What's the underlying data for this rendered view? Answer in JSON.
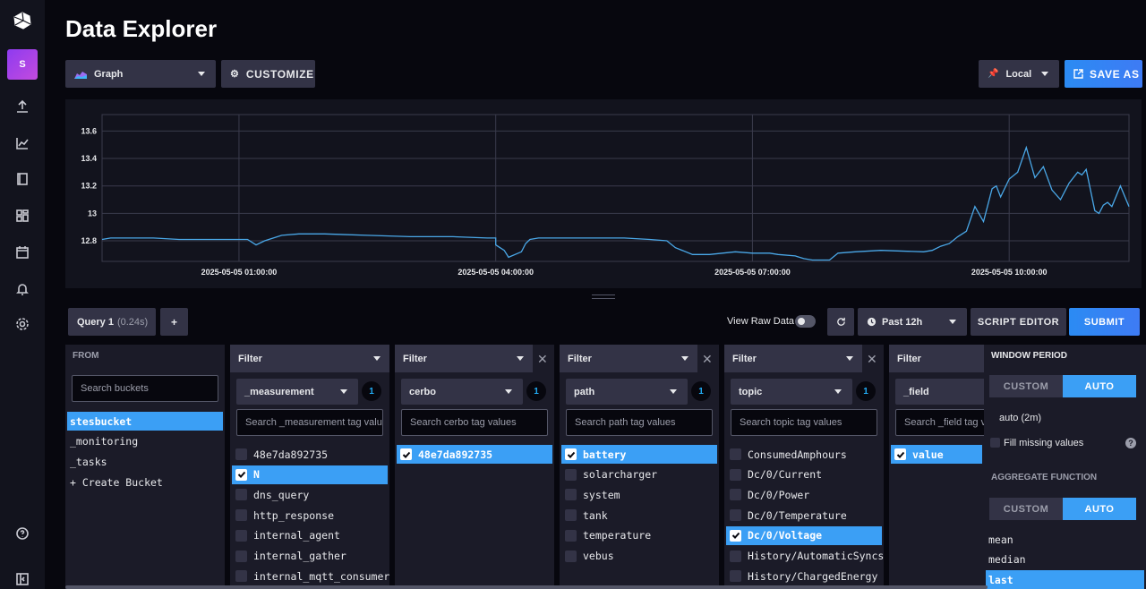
{
  "page": {
    "title": "Data Explorer"
  },
  "nav": {
    "user_initial": "S"
  },
  "toolbar": {
    "view_type": "Graph",
    "customize_label": "CUSTOMIZE",
    "timezone": "Local",
    "save_as_label": "SAVE AS"
  },
  "chart_data": {
    "type": "line",
    "title": "",
    "xlabel": "",
    "ylabel": "",
    "ylim": [
      12.65,
      13.72
    ],
    "yticks": [
      "12.8",
      "13",
      "13.2",
      "13.4",
      "13.6"
    ],
    "xticks": [
      "2025-05-05 01:00:00",
      "2025-05-05 04:00:00",
      "2025-05-05 07:00:00",
      "2025-05-05 10:00:00"
    ],
    "xrange_hours": [
      -0.6,
      11.4
    ],
    "color": "#4aa8e8",
    "series": [
      {
        "x": [
          -0.6,
          -0.5,
          -0.3,
          0,
          0.3,
          0.6,
          0.9,
          1.1,
          1.2,
          1.3,
          1.5,
          1.7,
          2,
          2.5,
          3,
          3.5,
          3.9,
          4,
          4.0,
          4.1,
          4.15,
          4.3,
          4.35,
          4.4,
          4.5,
          5,
          5.5,
          5.8,
          6,
          6.1,
          6.3,
          6.5,
          6.8,
          7,
          7.2,
          7.3,
          7.5,
          7.6,
          7.7,
          7.9,
          8,
          8.2,
          8.5,
          9,
          9.1,
          9.2,
          9.3,
          9.4,
          9.5,
          9.6,
          9.7,
          9.8,
          9.85,
          9.9,
          10,
          10.1,
          10.2,
          10.3,
          10.4,
          10.5,
          10.6,
          10.7,
          10.8,
          10.85,
          10.9,
          11,
          11.05,
          11.1,
          11.15,
          11.2,
          11.3,
          11.4
        ],
        "y": [
          12.81,
          12.82,
          12.82,
          12.82,
          12.81,
          12.81,
          12.81,
          12.81,
          12.77,
          12.8,
          12.84,
          12.85,
          12.85,
          12.84,
          12.83,
          12.83,
          12.82,
          12.82,
          12.77,
          12.73,
          12.68,
          12.72,
          12.78,
          12.81,
          12.82,
          12.82,
          12.82,
          12.81,
          12.8,
          12.75,
          12.7,
          12.7,
          12.72,
          12.71,
          12.71,
          12.7,
          12.69,
          12.67,
          12.66,
          12.66,
          12.71,
          12.72,
          12.73,
          12.72,
          12.73,
          12.76,
          12.78,
          12.83,
          12.87,
          13.05,
          12.94,
          13.18,
          13.2,
          13.12,
          13.25,
          13.3,
          13.48,
          13.26,
          13.34,
          13.17,
          13.1,
          13.22,
          13.3,
          13.28,
          13.32,
          13.02,
          13.0,
          13.06,
          13.08,
          13.05,
          13.2,
          13.05
        ]
      }
    ]
  },
  "query": {
    "tab_label": "Query 1",
    "tab_time": "(0.24s)",
    "add_label": "+",
    "view_raw_label": "View Raw Data",
    "time_range": "Past 12h",
    "script_editor_label": "SCRIPT EDITOR",
    "submit_label": "SUBMIT"
  },
  "from": {
    "title": "FROM",
    "search_placeholder": "Search buckets",
    "buckets": [
      "stesbucket",
      "_monitoring",
      "_tasks",
      "+ Create Bucket"
    ]
  },
  "filters": [
    {
      "head": "Filter",
      "key": "_measurement",
      "count": "1",
      "placeholder": "Search _measurement tag values",
      "items": [
        "48e7da892735",
        "N",
        "dns_query",
        "http_response",
        "internal_agent",
        "internal_gather",
        "internal_mqtt_consumer"
      ]
    },
    {
      "head": "Filter",
      "key": "cerbo",
      "count": "1",
      "placeholder": "Search cerbo tag values",
      "items": [
        "48e7da892735"
      ]
    },
    {
      "head": "Filter",
      "key": "path",
      "count": "1",
      "placeholder": "Search path tag values",
      "items": [
        "battery",
        "solarcharger",
        "system",
        "tank",
        "temperature",
        "vebus"
      ]
    },
    {
      "head": "Filter",
      "key": "topic",
      "count": "1",
      "placeholder": "Search topic tag values",
      "items": [
        "ConsumedAmphours",
        "Dc/0/Current",
        "Dc/0/Power",
        "Dc/0/Temperature",
        "Dc/0/Voltage",
        "History/AutomaticSyncs",
        "History/ChargedEnergy"
      ]
    },
    {
      "head": "Filter",
      "key": "_field",
      "count": "",
      "placeholder": "Search _field tag values",
      "items": [
        "value"
      ]
    }
  ],
  "aggregate": {
    "window_title": "WINDOW PERIOD",
    "custom_label": "CUSTOM",
    "auto_label": "AUTO",
    "auto_value": "auto (2m)",
    "fill_missing": "Fill missing values",
    "help": "?",
    "fn_title": "AGGREGATE FUNCTION",
    "functions": [
      "mean",
      "median",
      "last"
    ]
  }
}
